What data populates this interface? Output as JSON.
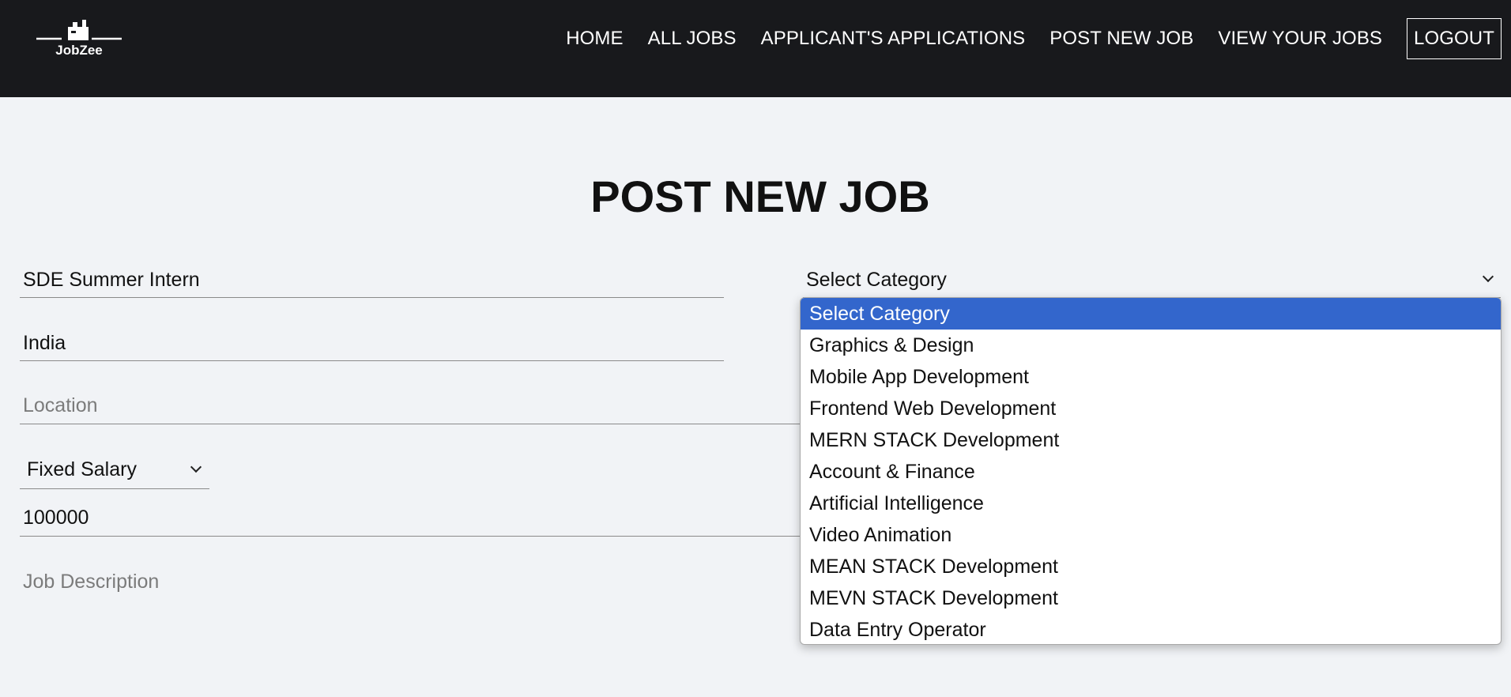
{
  "brand": {
    "name": "JobZee"
  },
  "nav": {
    "items": [
      "HOME",
      "ALL JOBS",
      "APPLICANT'S APPLICATIONS",
      "POST NEW JOB",
      "VIEW YOUR JOBS"
    ],
    "logout": "LOGOUT"
  },
  "page": {
    "title": "POST NEW JOB"
  },
  "form": {
    "title_value": "SDE Summer Intern",
    "country_value": "India",
    "location_placeholder": "Location",
    "salary_type": "Fixed Salary",
    "salary_value": "100000",
    "description_placeholder": "Job Description",
    "category_selected": "Select Category"
  },
  "category_dropdown": {
    "options": [
      "Select Category",
      "Graphics & Design",
      "Mobile App Development",
      "Frontend Web Development",
      "MERN STACK Development",
      "Account & Finance",
      "Artificial Intelligence",
      "Video Animation",
      "MEAN STACK Development",
      "MEVN STACK Development",
      "Data Entry Operator"
    ],
    "highlighted": "Select Category"
  },
  "colors": {
    "navbar_bg": "#18191c",
    "page_bg": "#f1f3f6",
    "highlight": "#3366cc"
  }
}
